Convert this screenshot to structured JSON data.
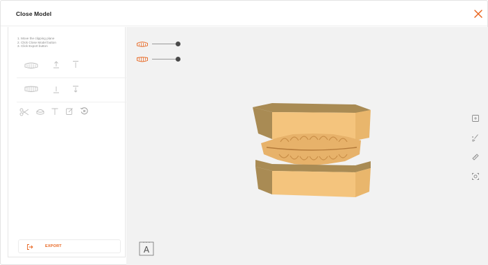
{
  "window": {
    "title": "Close Model"
  },
  "instructions": [
    "1. Move the clipping plane",
    "2. Click Close Model button",
    "3. Click Export button"
  ],
  "export": {
    "label": "EXPORT"
  },
  "label_tool": {
    "glyph": "A"
  },
  "colors": {
    "accent": "#e8641e",
    "model_face": "#f4c47d",
    "model_side": "#a98b54",
    "viewport_bg": "#f2f2f2"
  }
}
